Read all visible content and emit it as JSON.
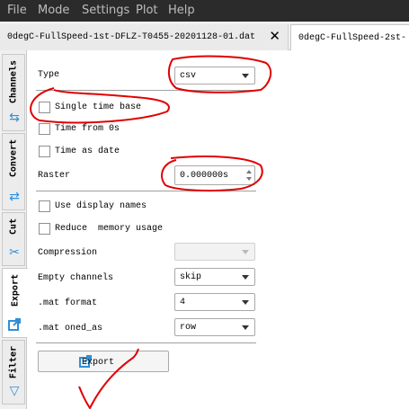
{
  "menubar": {
    "items": [
      "File",
      "Mode",
      "Settings",
      "Plot",
      "Help"
    ]
  },
  "tabs": [
    {
      "label": "0degC-FullSpeed-1st-DFLZ-T0455-20201128-01.dat",
      "close": "✕"
    },
    {
      "label": "0degC-FullSpeed-2st-"
    }
  ],
  "side_tabs": [
    {
      "label": "Channels",
      "icon": "channels-icon"
    },
    {
      "label": "Convert",
      "icon": "convert-icon"
    },
    {
      "label": "Cut",
      "icon": "scissors-icon"
    },
    {
      "label": "Export",
      "icon": "export-icon",
      "active": true
    },
    {
      "label": "Filter",
      "icon": "filter-icon"
    }
  ],
  "export": {
    "type_label": "Type",
    "type_value": "csv",
    "single_time_base": {
      "label": "Single time base",
      "checked": false
    },
    "time_from_0s": {
      "label": "Time from 0s",
      "checked": false
    },
    "time_as_date": {
      "label": "Time as date",
      "checked": false
    },
    "raster_label": "Raster",
    "raster_value": "0.000000s",
    "use_display_names": {
      "label": "Use display names",
      "checked": false
    },
    "reduce_memory": {
      "label": "Reduce  memory usage",
      "checked": false
    },
    "compression_label": "Compression",
    "compression_value": "",
    "empty_channels_label": "Empty channels",
    "empty_channels_value": "skip",
    "mat_format_label": ".mat format",
    "mat_format_value": "4",
    "mat_oned_label": ".mat oned_as",
    "mat_oned_value": "row",
    "export_button": "Export"
  },
  "colors": {
    "menubar_bg": "#2b2b2b",
    "accent": "#2f8fd8",
    "annotation": "#e00000"
  }
}
